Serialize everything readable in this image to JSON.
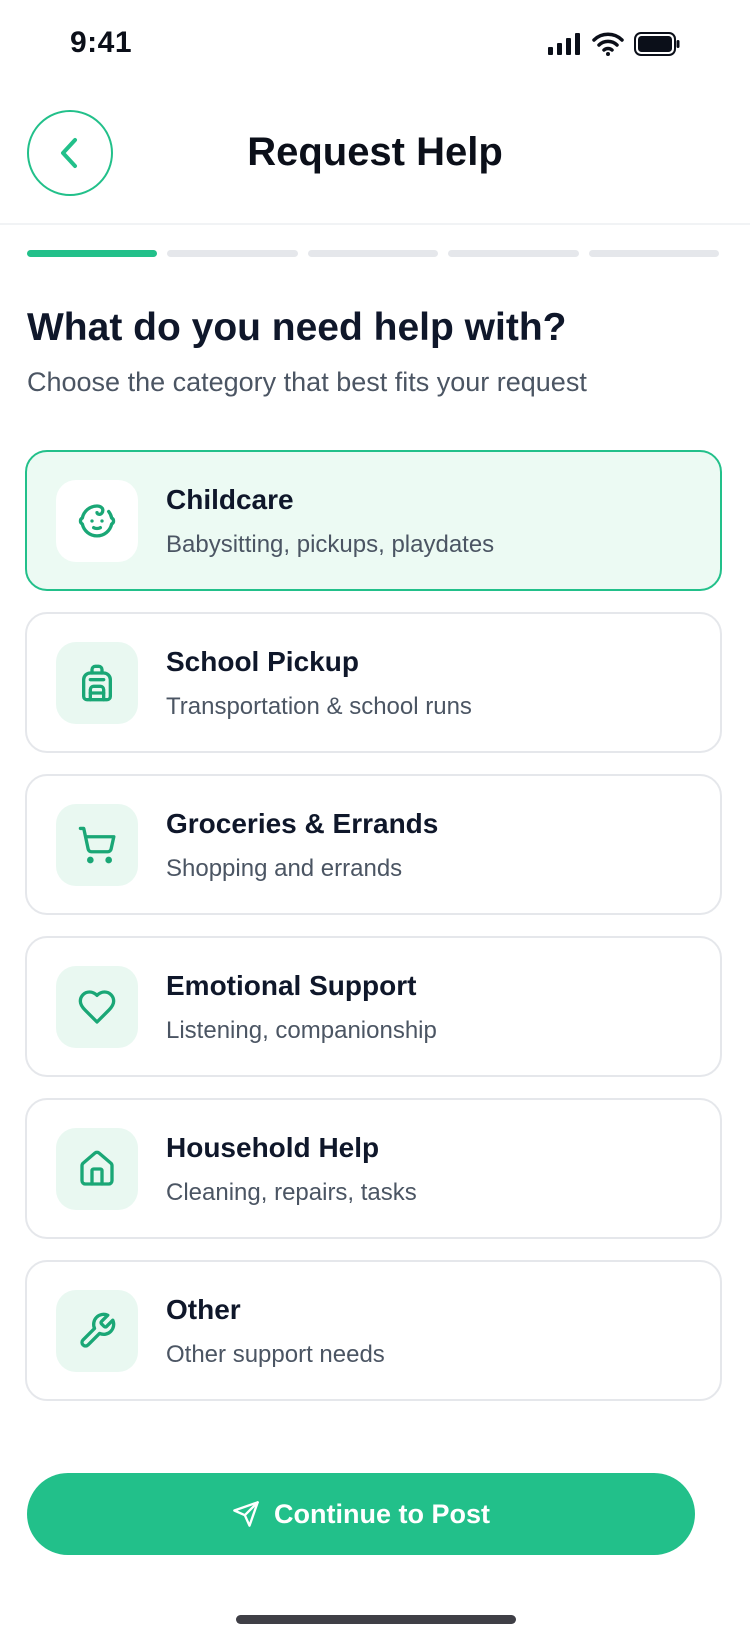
{
  "status_bar": {
    "time": "9:41"
  },
  "header": {
    "title": "Request Help"
  },
  "progress": {
    "total_steps": 5,
    "current_step": 1
  },
  "question": {
    "title": "What do you need help with?",
    "subtitle": "Choose the category that best fits your request"
  },
  "categories": [
    {
      "title": "Childcare",
      "description": "Babysitting, pickups, playdates",
      "icon": "baby-face-icon",
      "selected": true
    },
    {
      "title": "School Pickup",
      "description": "Transportation & school runs",
      "icon": "backpack-icon",
      "selected": false
    },
    {
      "title": "Groceries & Errands",
      "description": "Shopping and errands",
      "icon": "cart-icon",
      "selected": false
    },
    {
      "title": "Emotional Support",
      "description": "Listening, companionship",
      "icon": "heart-icon",
      "selected": false
    },
    {
      "title": "Household Help",
      "description": "Cleaning, repairs, tasks",
      "icon": "home-icon",
      "selected": false
    },
    {
      "title": "Other",
      "description": "Other support needs",
      "icon": "wrench-icon",
      "selected": false
    }
  ],
  "continue_button": {
    "label": "Continue to Post",
    "icon": "send-icon"
  },
  "colors": {
    "accent": "#22c08a",
    "accent_light": "#ecfaf3",
    "text_primary": "#0f172a",
    "text_secondary": "#4b5563"
  }
}
